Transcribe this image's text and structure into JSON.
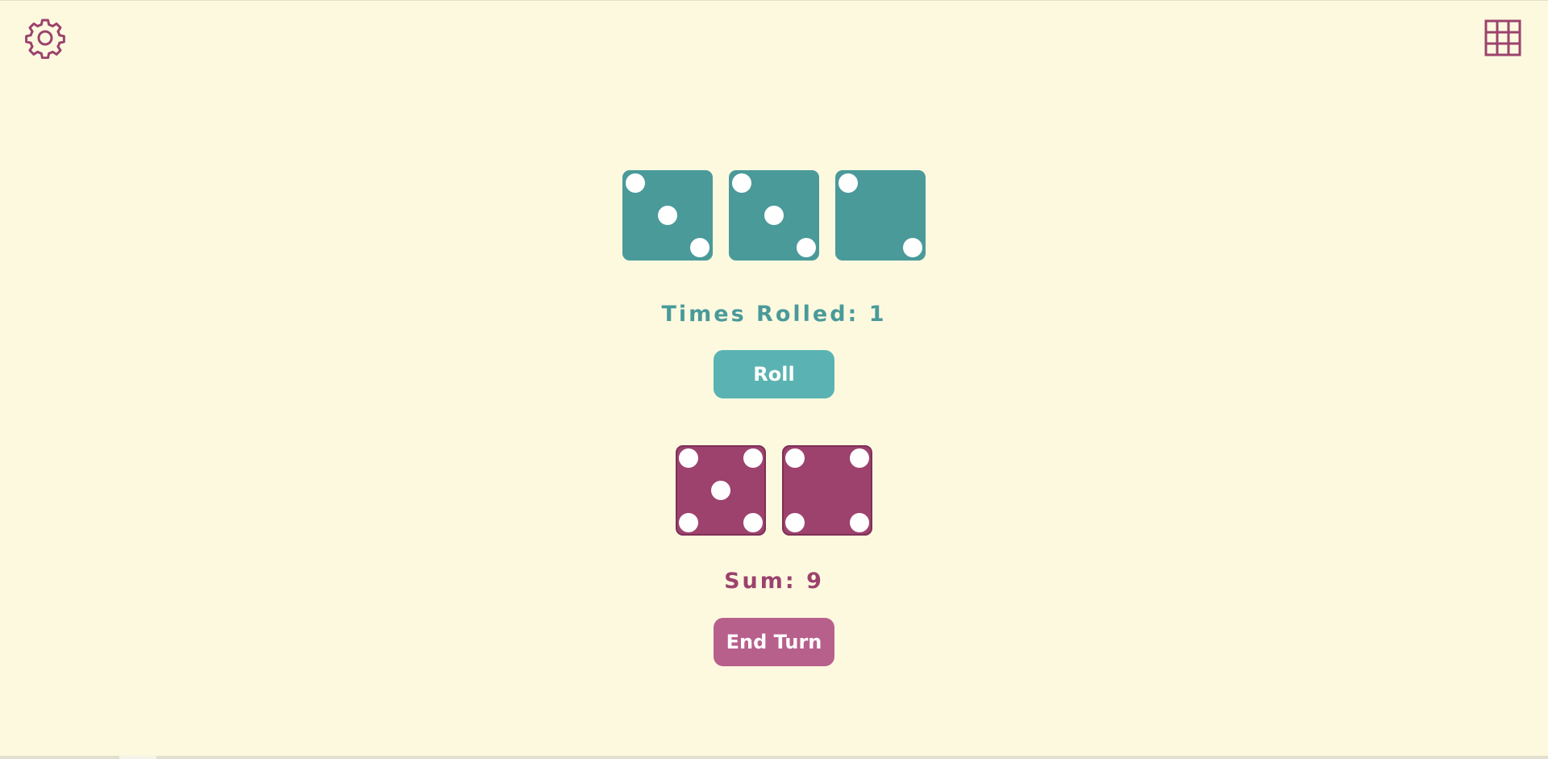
{
  "colors": {
    "background": "#fdf9df",
    "teal": "#4a9a9a",
    "teal_button": "#5ab3b2",
    "magenta": "#9c426d",
    "magenta_button": "#b8608c",
    "pip": "#ffffff"
  },
  "toolbar": {
    "settings_icon": "gear-icon",
    "grid_icon": "grid-icon"
  },
  "roll_dice": [
    3,
    3,
    2
  ],
  "kept_dice": [
    5,
    4
  ],
  "status": {
    "rolled_label": "Times Rolled: 1",
    "sum_label": "Sum: 9"
  },
  "buttons": {
    "roll": "Roll",
    "end_turn": "End Turn"
  }
}
